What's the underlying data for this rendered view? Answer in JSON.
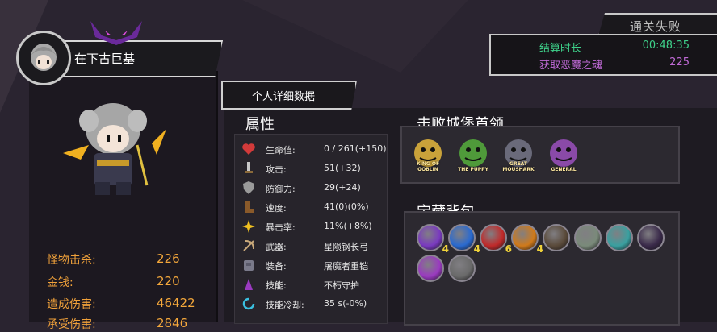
{
  "player": {
    "name": "在下古巨基"
  },
  "results": {
    "status": "通关失败",
    "rows": [
      {
        "label": "结算时长",
        "value": "00:48:35",
        "color": "#3ed18a"
      },
      {
        "label": "获取恶魔之魂",
        "value": "225",
        "color": "#c06ad6"
      }
    ]
  },
  "summary_stats": [
    {
      "label": "怪物击杀:",
      "value": "226"
    },
    {
      "label": "金钱:",
      "value": "220"
    },
    {
      "label": "造成伤害:",
      "value": "46422"
    },
    {
      "label": "承受伤害:",
      "value": "2846"
    }
  ],
  "detail_tab": "个人详细数据",
  "attributes": {
    "title": "属性",
    "items": [
      {
        "icon": "heart-icon",
        "label": "生命值:",
        "value": "0 / 261(+150)"
      },
      {
        "icon": "sword-icon",
        "label": "攻击:",
        "value": "51(+32)"
      },
      {
        "icon": "shield-icon",
        "label": "防御力:",
        "value": "29(+24)"
      },
      {
        "icon": "boot-icon",
        "label": "速度:",
        "value": "41(0)(0%)"
      },
      {
        "icon": "critical-burst-icon",
        "label": "暴击率:",
        "value": "11%(+8%)"
      },
      {
        "icon": "weapon-icon",
        "label": "武器:",
        "value": "星陨钢长弓"
      },
      {
        "icon": "armor-icon",
        "label": "装备:",
        "value": "屠魔者重铠"
      },
      {
        "icon": "skill-icon",
        "label": "技能:",
        "value": "不朽守护"
      },
      {
        "icon": "cooldown-icon",
        "label": "技能冷却:",
        "value": "35 s(-0%)"
      }
    ]
  },
  "bosses": {
    "title": "击败城堡首领",
    "items": [
      {
        "name": "KING OF GOBLIN",
        "color": "#c9a23a"
      },
      {
        "name": "THE PUPPY",
        "color": "#4f9a3a"
      },
      {
        "name": "GREAT MOUSHARK",
        "color": "#6a6a7a"
      },
      {
        "name": "GENERAL",
        "color": "#8a4aa8"
      }
    ]
  },
  "inventory": {
    "title": "宝藏背包",
    "items": [
      {
        "icon": "purple-crystal-icon",
        "color": "#7a3ac0",
        "count": "4"
      },
      {
        "icon": "blue-orb-icon",
        "color": "#2a6ad0",
        "count": "4"
      },
      {
        "icon": "red-heart-gem-icon",
        "color": "#c02a2a",
        "count": "6"
      },
      {
        "icon": "orange-flame-gem-icon",
        "color": "#d07a1a",
        "count": "4"
      },
      {
        "icon": "dark-hood-relic-icon",
        "color": "#5a4a3a",
        "count": ""
      },
      {
        "icon": "stone-eye-relic-icon",
        "color": "#7a8a7a",
        "count": ""
      },
      {
        "icon": "teal-wing-relic-icon",
        "color": "#3aa0a0",
        "count": ""
      },
      {
        "icon": "shadow-orb-relic-icon",
        "color": "#3a2a4a",
        "count": ""
      },
      {
        "icon": "violet-rune-relic-icon",
        "color": "#9a3ac0",
        "count": ""
      },
      {
        "icon": "ring-chain-relic-icon",
        "color": "#6a6a6a",
        "count": ""
      }
    ]
  }
}
